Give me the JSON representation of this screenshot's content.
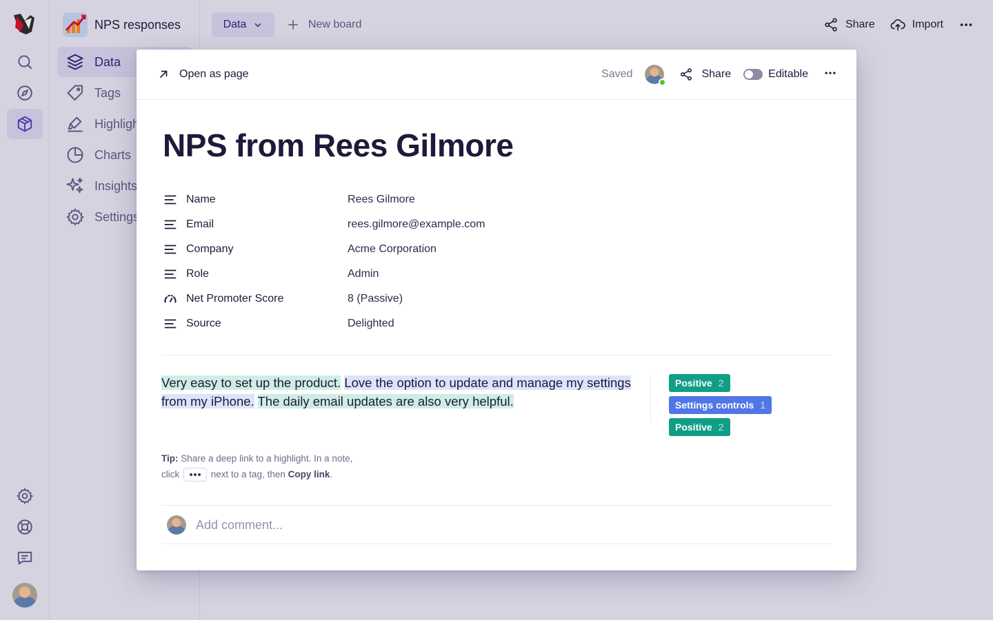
{
  "app": {
    "board_name": "NPS responses"
  },
  "sidebar": {
    "items": [
      {
        "label": "Data",
        "icon": "layers-icon"
      },
      {
        "label": "Tags",
        "icon": "tag-icon"
      },
      {
        "label": "Highlights",
        "icon": "highlighter-icon"
      },
      {
        "label": "Charts",
        "icon": "pie-chart-icon"
      },
      {
        "label": "Insights",
        "icon": "sparkle-icon"
      },
      {
        "label": "Settings",
        "icon": "gear-icon"
      }
    ]
  },
  "topbar": {
    "view_label": "Data",
    "new_board_label": "New board",
    "share_label": "Share",
    "import_label": "Import"
  },
  "modal": {
    "open_as_page_label": "Open as page",
    "saved_label": "Saved",
    "share_label": "Share",
    "editable_label": "Editable",
    "title": "NPS from Rees Gilmore",
    "properties": [
      {
        "label": "Name",
        "value": "Rees Gilmore",
        "icon": "text-lines-icon"
      },
      {
        "label": "Email",
        "value": "rees.gilmore@example.com",
        "icon": "text-lines-icon"
      },
      {
        "label": "Company",
        "value": "Acme Corporation",
        "icon": "text-lines-icon"
      },
      {
        "label": "Role",
        "value": "Admin",
        "icon": "text-lines-icon"
      },
      {
        "label": "Net Promoter Score",
        "value": "8 (Passive)",
        "icon": "gauge-icon"
      },
      {
        "label": "Source",
        "value": "Delighted",
        "icon": "text-lines-icon"
      }
    ],
    "quote": {
      "segments": [
        {
          "text": "Very easy to set up the product.",
          "highlight": "green"
        },
        {
          "text": " ",
          "highlight": "none"
        },
        {
          "text": "Love the option to update and manage my settings from my iPhone.",
          "highlight": "blue"
        },
        {
          "text": " ",
          "highlight": "none"
        },
        {
          "text": "The daily email updates are also very helpful.",
          "highlight": "green"
        }
      ]
    },
    "tags": [
      {
        "label": "Positive",
        "count": "2",
        "color": "#0f9e86"
      },
      {
        "label": "Settings controls",
        "count": "1",
        "color": "#5176e6"
      },
      {
        "label": "Positive",
        "count": "2",
        "color": "#0f9e86"
      }
    ],
    "tip": {
      "prefix": "Tip:",
      "line1": " Share a deep link to a highlight. In a note,",
      "line2_start": "click",
      "line2_mid": " next to a tag, then ",
      "line2_bold": "Copy link",
      "line2_end": "."
    },
    "comment": {
      "placeholder": "Add comment..."
    }
  },
  "colors": {
    "highlight_green": "#cfeee3",
    "highlight_blue": "#dce3fb",
    "accent": "#4a3fa8"
  }
}
